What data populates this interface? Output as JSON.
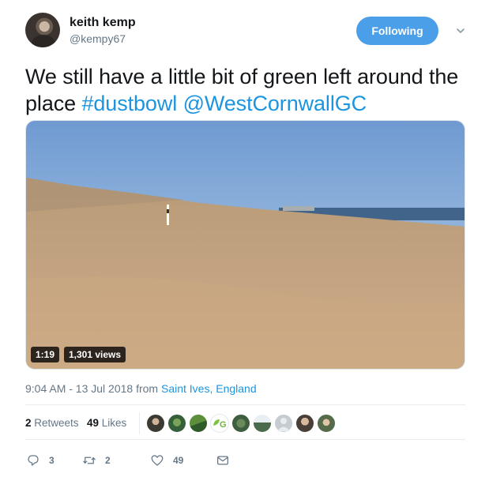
{
  "user": {
    "name": "keith kemp",
    "handle": "@kempy67",
    "follow_label": "Following"
  },
  "tweet": {
    "text_plain": "We still have a little bit of green left around the place",
    "hashtag": "#dustbowl",
    "mention": "@WestCornwallGC"
  },
  "video": {
    "duration": "1:19",
    "views": "1,301 views"
  },
  "meta": {
    "time": "9:04 AM - 13 Jul 2018 from ",
    "place": "Saint Ives, England"
  },
  "stats": {
    "retweets_count": "2",
    "retweets_label": "Retweets",
    "likes_count": "49",
    "likes_label": "Likes"
  },
  "actions": {
    "reply_count": "3",
    "retweet_count": "2",
    "like_count": "49"
  },
  "colors": {
    "accent": "#1b95e0",
    "follow_button": "#4a9fe8",
    "muted": "#657786"
  }
}
